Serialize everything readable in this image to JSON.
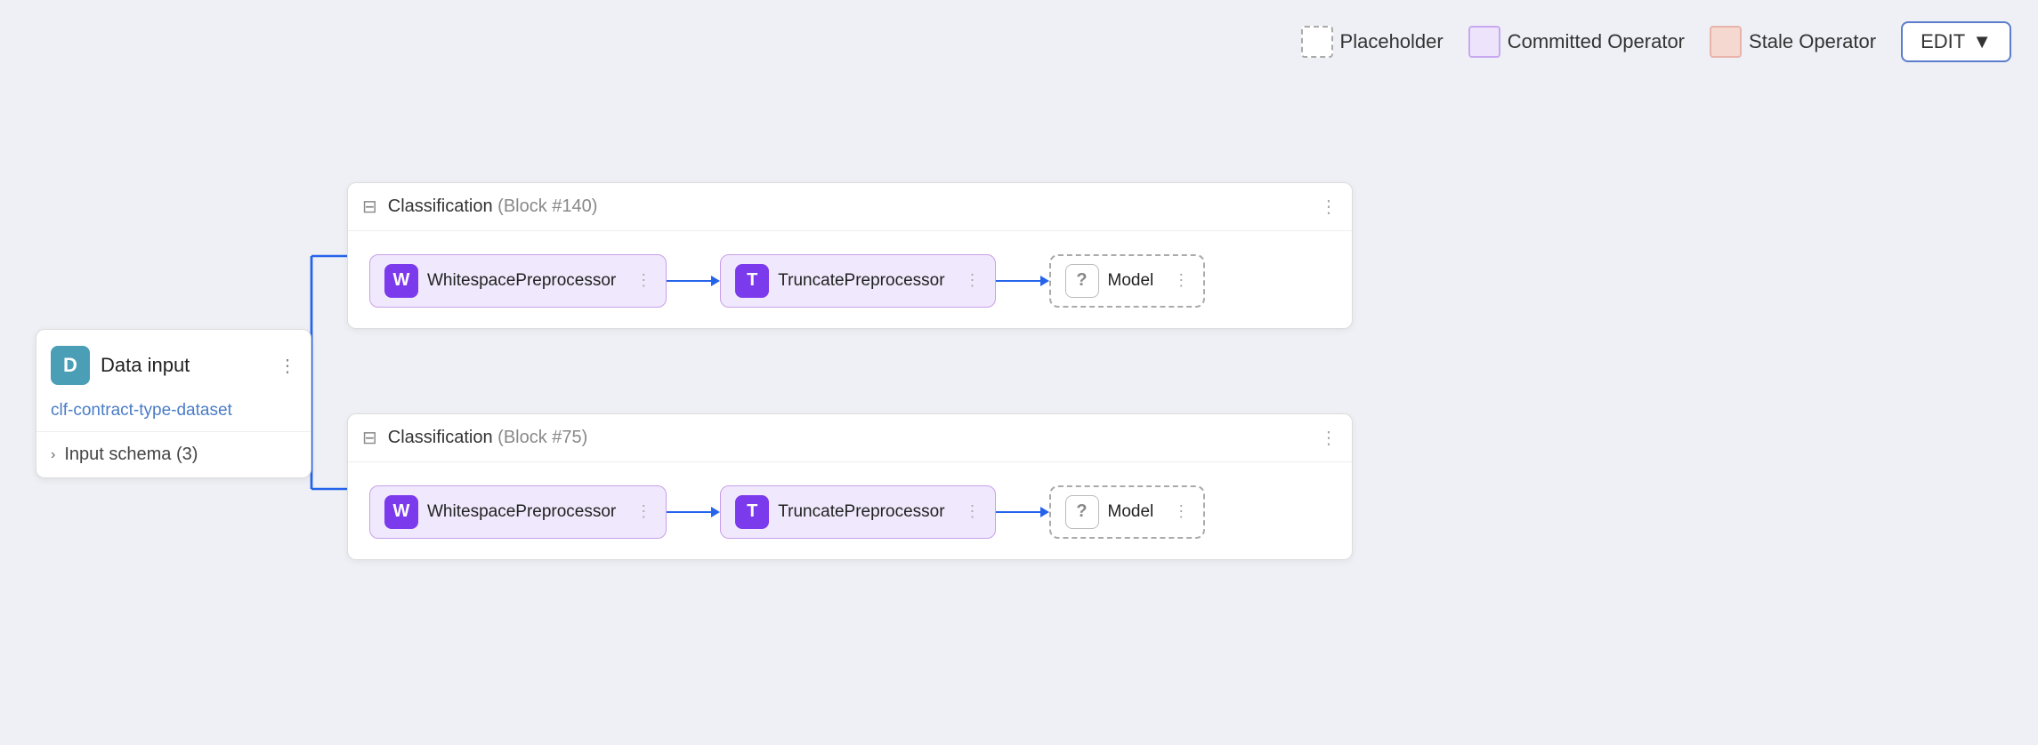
{
  "legend": {
    "placeholder_label": "Placeholder",
    "committed_label": "Committed Operator",
    "stale_label": "Stale Operator",
    "edit_button": "EDIT"
  },
  "data_input_node": {
    "icon_letter": "D",
    "title": "Data input",
    "link_text": "clf-contract-type-dataset",
    "schema_label": "Input schema (3)"
  },
  "block1": {
    "title": "Classification",
    "id": "(Block #140)",
    "operators": [
      {
        "icon": "W",
        "label": "WhitespacePreprocessor"
      },
      {
        "icon": "T",
        "label": "TruncatePreprocessor"
      },
      {
        "icon": "?",
        "label": "Model",
        "placeholder": true
      }
    ]
  },
  "block2": {
    "title": "Classification",
    "id": "(Block #75)",
    "operators": [
      {
        "icon": "W",
        "label": "WhitespacePreprocessor"
      },
      {
        "icon": "T",
        "label": "TruncatePreprocessor"
      },
      {
        "icon": "?",
        "label": "Model",
        "placeholder": true
      }
    ]
  }
}
